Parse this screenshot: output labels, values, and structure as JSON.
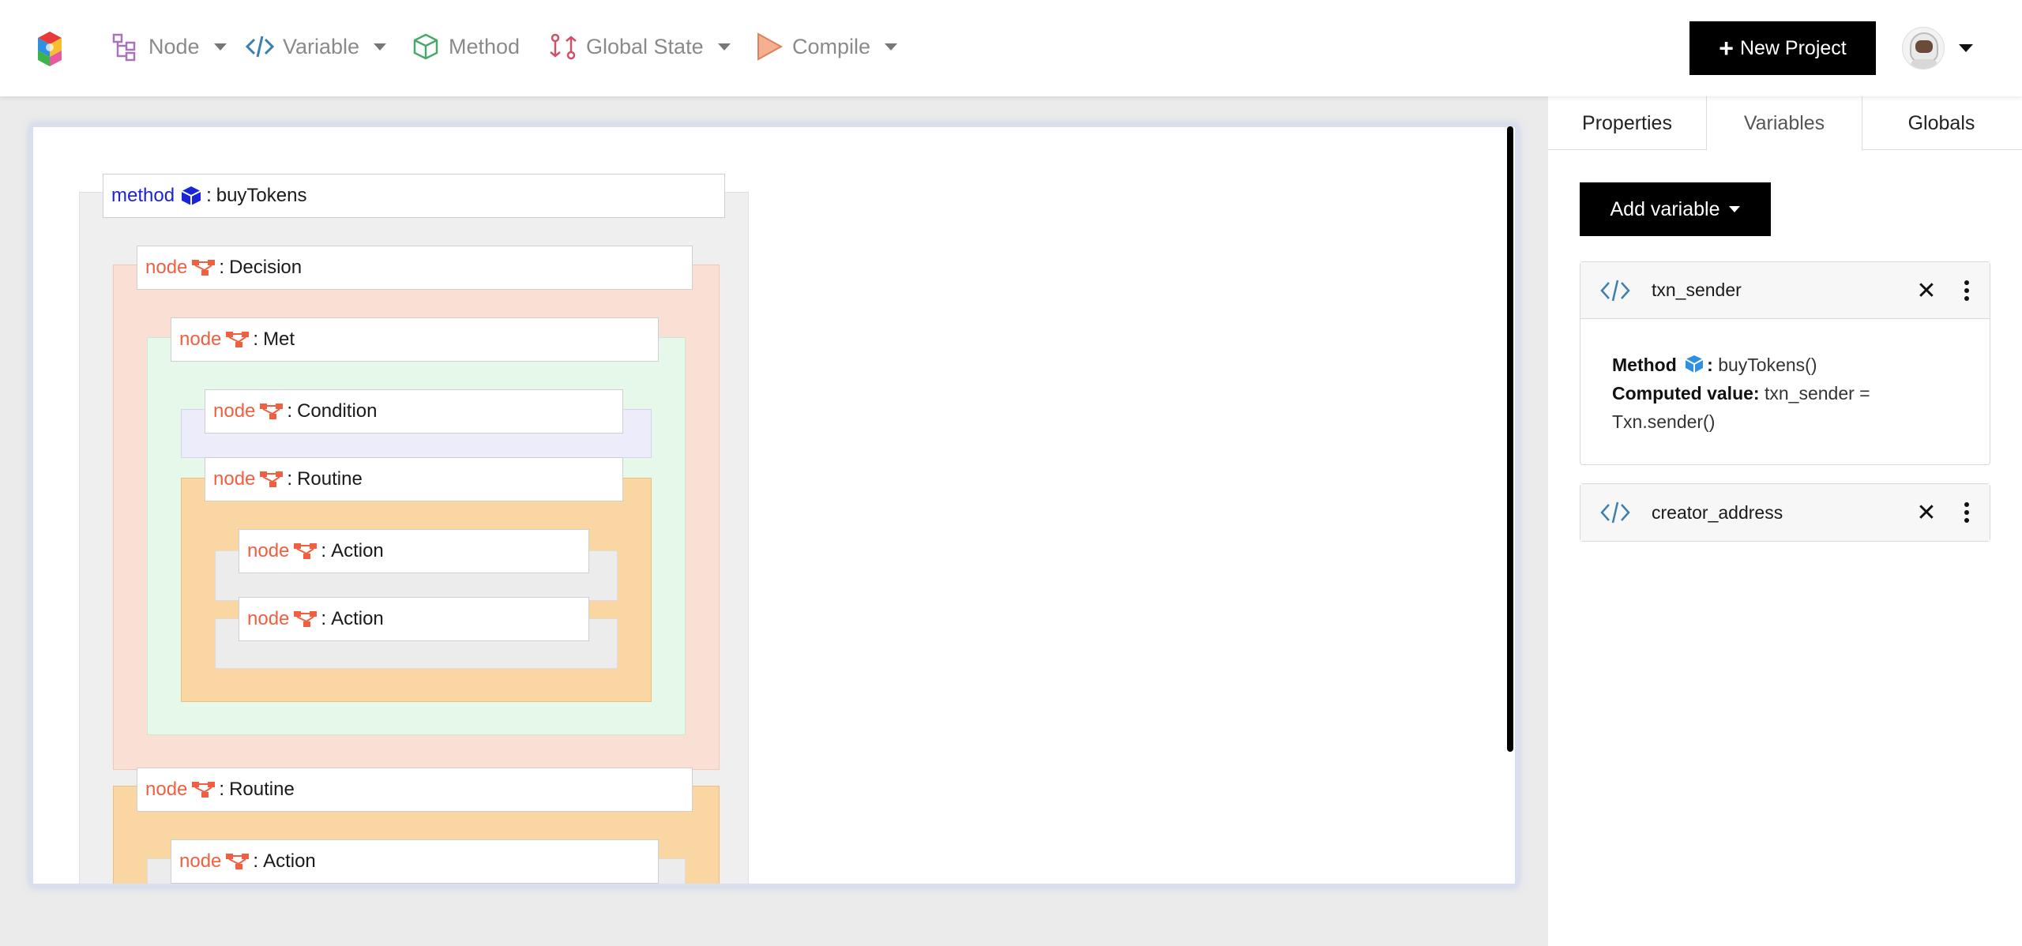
{
  "navbar": {
    "items": [
      {
        "label": "Node",
        "icon": "node-tree-icon",
        "dropdown": true
      },
      {
        "label": "Variable",
        "icon": "code-icon",
        "dropdown": true
      },
      {
        "label": "Method",
        "icon": "cube-icon",
        "dropdown": false
      },
      {
        "label": "Global State",
        "icon": "git-compare-icon",
        "dropdown": true
      },
      {
        "label": "Compile",
        "icon": "play-icon",
        "dropdown": true
      }
    ],
    "new_project_label": "New Project"
  },
  "canvas": {
    "method": {
      "keyword": "method",
      "separator": ":",
      "name": "buyTokens"
    },
    "nodes": [
      {
        "keyword": "node",
        "separator": ":",
        "name": "Decision"
      },
      {
        "keyword": "node",
        "separator": ":",
        "name": "Met"
      },
      {
        "keyword": "node",
        "separator": ":",
        "name": "Condition"
      },
      {
        "keyword": "node",
        "separator": ":",
        "name": "Routine"
      },
      {
        "keyword": "node",
        "separator": ":",
        "name": "Action"
      },
      {
        "keyword": "node",
        "separator": ":",
        "name": "Action"
      },
      {
        "keyword": "node",
        "separator": ":",
        "name": "Routine"
      },
      {
        "keyword": "node",
        "separator": ":",
        "name": "Action"
      }
    ],
    "colors": {
      "method_bg": "#efefef",
      "decision_bg": "#f9dfd4",
      "met_bg": "#e6f8ea",
      "condition_bg": "#ececfb",
      "routine_bg": "#fad7a2",
      "action_bg": "#ececec",
      "node_keyword": "#f06040",
      "method_keyword": "#1a23d8"
    }
  },
  "panel": {
    "tabs": [
      {
        "label": "Properties",
        "active": false
      },
      {
        "label": "Variables",
        "active": true
      },
      {
        "label": "Globals",
        "active": false
      }
    ],
    "add_variable_label": "Add variable",
    "variables": [
      {
        "name": "txn_sender",
        "method_label": "Method",
        "method_value": "buyTokens()",
        "computed_label": "Computed value:",
        "computed_value": "txn_sender = Txn.sender()"
      },
      {
        "name": "creator_address"
      }
    ]
  }
}
